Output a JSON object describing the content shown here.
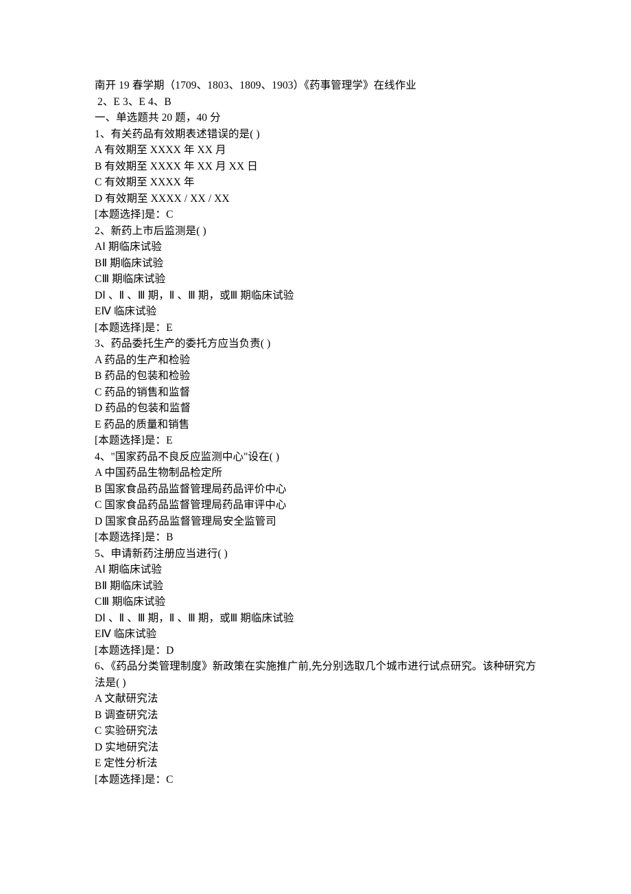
{
  "header": {
    "line1": "南开 19 春学期（1709、1803、1809、1903）《药事管理学》在线作业",
    "line2": " 2、E 3、E 4、B",
    "section": "一、单选题共 20 题，40 分"
  },
  "questions": [
    {
      "prompt": "1、有关药品有效期表述错误的是( )",
      "options": [
        "A 有效期至 XXXX 年 XX 月",
        "B 有效期至 XXXX 年 XX 月 XX 日",
        "C 有效期至 XXXX 年",
        "D 有效期至 XXXX / XX / XX"
      ],
      "answer": "[本题选择]是：C"
    },
    {
      "prompt": "2、新药上市后监测是( )",
      "options": [
        "AⅠ 期临床试验",
        "BⅡ 期临床试验",
        "CⅢ 期临床试验",
        "DⅠ 、Ⅱ 、Ⅲ 期，Ⅱ 、Ⅲ 期，或Ⅲ 期临床试验",
        "EⅣ 临床试验"
      ],
      "answer": "[本题选择]是：E"
    },
    {
      "prompt": "3、药品委托生产的委托方应当负责( )",
      "options": [
        "A 药品的生产和检验",
        "B 药品的包装和检验",
        "C 药品的销售和监督",
        "D 药品的包装和监督",
        "E 药品的质量和销售"
      ],
      "answer": "[本题选择]是：E"
    },
    {
      "prompt": "4、\"国家药品不良反应监测中心\"设在( )",
      "options": [
        "A 中国药品生物制品检定所",
        "B 国家食品药品监督管理局药品评价中心",
        "C 国家食品药品监督管理局药品审评中心",
        "D 国家食品药品监督管理局安全监管司"
      ],
      "answer": "[本题选择]是：B"
    },
    {
      "prompt": "5、申请新药注册应当进行( )",
      "options": [
        "AⅠ 期临床试验",
        "BⅡ 期临床试验",
        "CⅢ 期临床试验",
        "DⅠ 、Ⅱ 、Ⅲ 期，Ⅱ 、Ⅲ 期，或Ⅲ 期临床试验",
        "EⅣ 临床试验"
      ],
      "answer": "[本题选择]是：D"
    },
    {
      "prompt": "6、《药品分类管理制度》新政策在实施推广前,先分别选取几个城市进行试点研究。该种研究方法是( )",
      "options": [
        "A 文献研究法",
        "B 调查研究法",
        "C 实验研究法",
        "D 实地研究法",
        "E 定性分析法"
      ],
      "answer": "[本题选择]是：C"
    }
  ]
}
